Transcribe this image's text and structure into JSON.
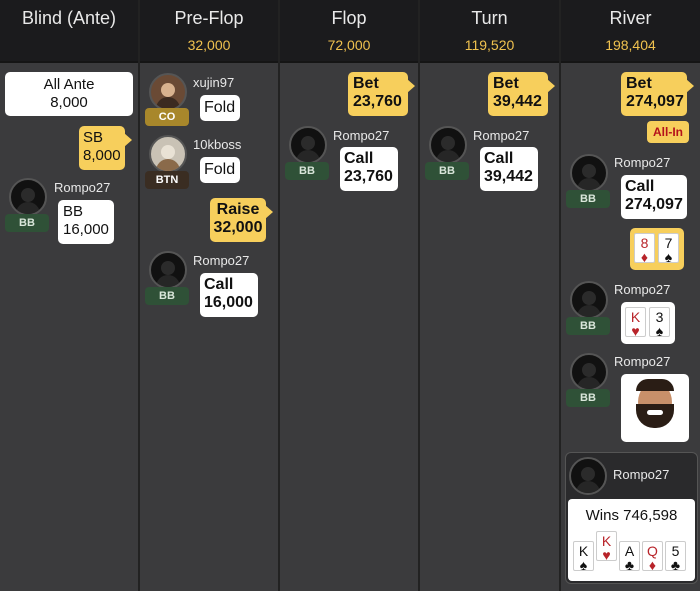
{
  "columns": [
    {
      "title": "Blind (Ante)",
      "pot": ""
    },
    {
      "title": "Pre-Flop",
      "pot": "32,000"
    },
    {
      "title": "Flop",
      "pot": "72,000"
    },
    {
      "title": "Turn",
      "pot": "119,520"
    },
    {
      "title": "River",
      "pot": "198,404"
    }
  ],
  "blind": {
    "ante_label": "All Ante",
    "ante_amount": "8,000",
    "sb_label": "SB",
    "sb_amount": "8,000",
    "bb_player": "Rompo27",
    "bb_pos": "BB",
    "bb_label": "BB",
    "bb_amount": "16,000"
  },
  "preflop": {
    "p1_name": "xujin97",
    "p1_pos": "CO",
    "p1_action": "Fold",
    "p2_name": "10kboss",
    "p2_pos": "BTN",
    "p2_action": "Fold",
    "raise_label": "Raise",
    "raise_amount": "32,000",
    "p3_name": "Rompo27",
    "p3_pos": "BB",
    "p3_action": "Call",
    "p3_amount": "16,000"
  },
  "flop": {
    "bet_label": "Bet",
    "bet_amount": "23,760",
    "p_name": "Rompo27",
    "p_pos": "BB",
    "p_action": "Call",
    "p_amount": "23,760"
  },
  "turn": {
    "bet_label": "Bet",
    "bet_amount": "39,442",
    "p_name": "Rompo27",
    "p_pos": "BB",
    "p_action": "Call",
    "p_amount": "39,442"
  },
  "river": {
    "bet_label": "Bet",
    "bet_amount": "274,097",
    "allin_label": "All-In",
    "p1_name": "Rompo27",
    "p1_pos": "BB",
    "p1_action": "Call",
    "p1_amount": "274,097",
    "villain_cards": [
      {
        "rank": "8",
        "suit": "♦",
        "red": true
      },
      {
        "rank": "7",
        "suit": "♠",
        "red": false
      }
    ],
    "p2_name": "Rompo27",
    "p2_pos": "BB",
    "hero_cards": [
      {
        "rank": "K",
        "suit": "♥",
        "red": true
      },
      {
        "rank": "3",
        "suit": "♠",
        "red": false
      }
    ],
    "p3_name": "Rompo27",
    "p3_pos": "BB",
    "winner_name": "Rompo27",
    "wins_text": "Wins 746,598",
    "best_hand": [
      {
        "rank": "K",
        "suit": "♠",
        "red": false
      },
      {
        "rank": "K",
        "suit": "♥",
        "red": true
      },
      {
        "rank": "A",
        "suit": "♣",
        "red": false
      },
      {
        "rank": "Q",
        "suit": "♦",
        "red": true
      },
      {
        "rank": "5",
        "suit": "♣",
        "red": false
      }
    ]
  }
}
